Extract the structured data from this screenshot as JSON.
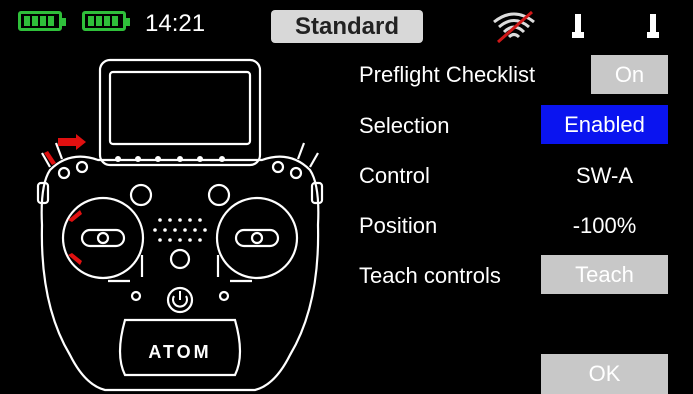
{
  "status_bar": {
    "time": "14:21",
    "model_name": "Standard",
    "battery_color": "#2fbf3a",
    "signal_icon": "wifi-off-icon",
    "antenna_icon": "antenna-icon"
  },
  "transmitter": {
    "brand": "ATOM"
  },
  "settings": {
    "preflight_checklist": {
      "label": "Preflight Checklist",
      "value": "On"
    },
    "selection": {
      "label": "Selection",
      "value": "Enabled"
    },
    "control": {
      "label": "Control",
      "value": "SW-A"
    },
    "position": {
      "label": "Position",
      "value": "-100%"
    },
    "teach_controls": {
      "label": "Teach controls",
      "value": "Teach"
    }
  },
  "ok_button": {
    "label": "OK"
  },
  "colors": {
    "accent_blue": "#0a14f0",
    "button_grey": "#c8c8c8",
    "highlight_red": "#e01010"
  }
}
